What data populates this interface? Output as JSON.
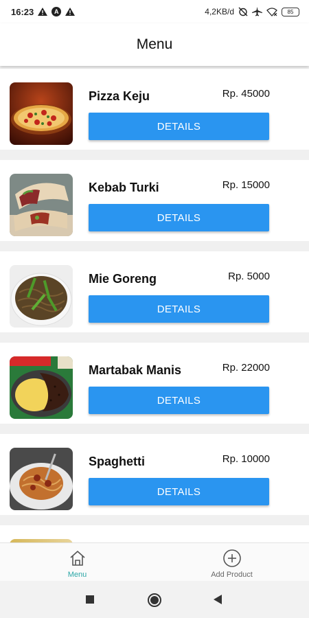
{
  "status_bar": {
    "time": "16:23",
    "network_speed": "4,2KB/d",
    "battery": "85",
    "icons": [
      "warning-icon",
      "a-icon",
      "warning-icon",
      "alarm-off-icon",
      "airplane-icon",
      "wifi-icon",
      "battery-icon"
    ]
  },
  "app_bar": {
    "title": "Menu"
  },
  "menu_items": [
    {
      "name": "Pizza Keju",
      "price": "Rp. 45000",
      "button": "DETAILS",
      "image": "pizza-image"
    },
    {
      "name": "Kebab Turki",
      "price": "Rp. 15000",
      "button": "DETAILS",
      "image": "kebab-image"
    },
    {
      "name": "Mie Goreng",
      "price": "Rp. 5000",
      "button": "DETAILS",
      "image": "noodles-image"
    },
    {
      "name": "Martabak Manis",
      "price": "Rp. 22000",
      "button": "DETAILS",
      "image": "martabak-image"
    },
    {
      "name": "Spaghetti",
      "price": "Rp. 10000",
      "button": "DETAILS",
      "image": "spaghetti-image"
    }
  ],
  "bottom_nav": {
    "items": [
      {
        "label": "Menu",
        "icon": "home-icon",
        "active": true
      },
      {
        "label": "Add Product",
        "icon": "add-circle-icon",
        "active": false
      }
    ]
  },
  "system_nav": {
    "icons": [
      "recents-square-icon",
      "home-circle-icon",
      "back-triangle-icon"
    ]
  },
  "colors": {
    "button_blue": "#2a95f0",
    "active_nav": "#2aa6a6",
    "background": "#f0f0f0"
  }
}
